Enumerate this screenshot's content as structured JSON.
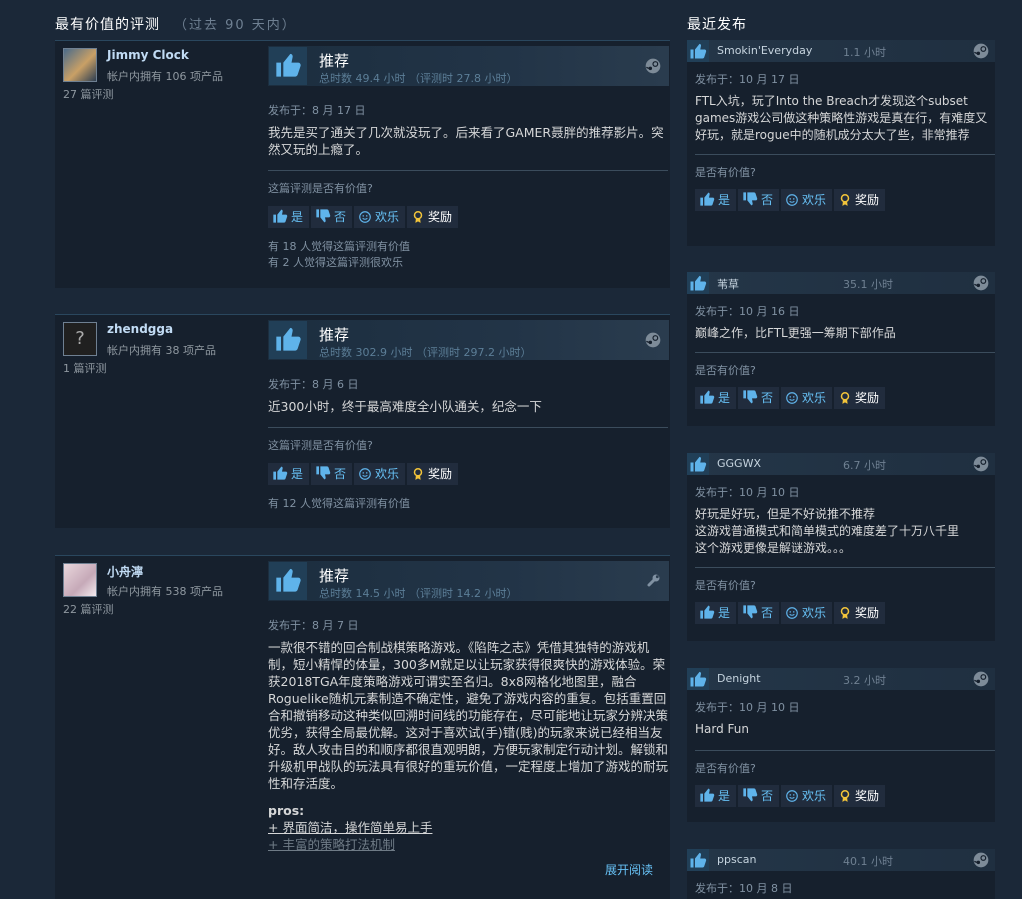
{
  "most_helpful": {
    "title": "最有价值的评测",
    "subtitle": "（过去 90 天内）",
    "reviews": [
      {
        "author": "Jimmy Clock",
        "owned": "帐户内拥有 106 项产品",
        "review_count": "27 篇评测",
        "recommend": "推荐",
        "hours": "总时数 49.4 小时 （评测时 27.8 小时）",
        "posted": "发布于：8 月 17 日",
        "text": "我先是买了通关了几次就没玩了。后来看了GAMER聂胖的推荐影片。突然又玩的上瘾了。",
        "helpful_q": "这篇评测是否有价值?",
        "yes": "是",
        "no": "否",
        "funny": "欢乐",
        "award": "奖励",
        "found1": "有 18 人觉得这篇评测有价值",
        "found2": "有 2 人觉得这篇评测很欢乐"
      },
      {
        "author": "zhendgga",
        "owned": "帐户内拥有 38 项产品",
        "review_count": "1 篇评测",
        "recommend": "推荐",
        "hours": "总时数 302.9 小时 （评测时 297.2 小时）",
        "posted": "发布于：8 月 6 日",
        "text": "近300小时，终于最高难度全小队通关，纪念一下",
        "helpful_q": "这篇评测是否有价值?",
        "yes": "是",
        "no": "否",
        "funny": "欢乐",
        "award": "奖励",
        "found1": "有 12 人觉得这篇评测有价值"
      },
      {
        "author": "小舟濘",
        "owned": "帐户内拥有 538 项产品",
        "review_count": "22 篇评测",
        "recommend": "推荐",
        "hours": "总时数 14.5 小时 （评测时 14.2 小时）",
        "posted": "发布于：8 月 7 日",
        "text": "一款很不错的回合制战棋策略游戏。《陷阵之志》凭借其独特的游戏机制，短小精悍的体量，300多M就足以让玩家获得很爽快的游戏体验。荣获2018TGA年度策略游戏可谓实至名归。8x8网格化地图里，融合Roguelike随机元素制造不确定性，避免了游戏内容的重复。包括重置回合和撤销移动这种类似回溯时间线的功能存在，尽可能地让玩家分辨决策优劣，获得全局最优解。这对于喜欢试(手)错(贱)的玩家来说已经相当友好。敌人攻击目的和顺序都很直观明朗，方便玩家制定行动计划。解锁和升级机甲战队的玩法具有很好的重玩价值，一定程度上增加了游戏的耐玩性和存活度。",
        "pros_label": "pros:",
        "pro1": "+ 界面简洁，操作简单易上手",
        "pro2": "+ 丰富的策略打法机制",
        "expand": "展开阅读"
      }
    ]
  },
  "recent": {
    "title": "最近发布",
    "items": [
      {
        "name": "Smokin'Everyday",
        "hours": "1.1 小时",
        "posted": "发布于：10 月 17 日",
        "text": "FTL入坑，玩了Into the Breach才发现这个subset games游戏公司做这种策略性游戏是真在行，有难度又好玩，就是rogue中的随机成分太大了些，非常推荐",
        "q": "是否有价值?",
        "yes": "是",
        "no": "否",
        "funny": "欢乐",
        "award": "奖励"
      },
      {
        "name": "苇草",
        "hours": "35.1 小时",
        "posted": "发布于：10 月 16 日",
        "text": "巅峰之作，比FTL更强一筹期下部作品",
        "q": "是否有价值?",
        "yes": "是",
        "no": "否",
        "funny": "欢乐",
        "award": "奖励"
      },
      {
        "name": "GGGWX",
        "hours": "6.7 小时",
        "posted": "发布于：10 月 10 日",
        "text": "好玩是好玩，但是不好说推不推荐\n这游戏普通模式和简单模式的难度差了十万八千里\n这个游戏更像是解谜游戏。。。",
        "q": "是否有价值?",
        "yes": "是",
        "no": "否",
        "funny": "欢乐",
        "award": "奖励"
      },
      {
        "name": "Denight",
        "hours": "3.2 小时",
        "posted": "发布于：10 月 10 日",
        "text": "Hard Fun",
        "q": "是否有价值?",
        "yes": "是",
        "no": "否",
        "funny": "欢乐",
        "award": "奖励"
      },
      {
        "name": "ppscan",
        "hours": "40.1 小时",
        "posted": "发布于：10 月 8 日"
      }
    ]
  },
  "colors": {
    "bg": "#1b2838",
    "panel": "#16202d",
    "accent": "#67c1f5",
    "thumb": "#3b8fcf"
  }
}
